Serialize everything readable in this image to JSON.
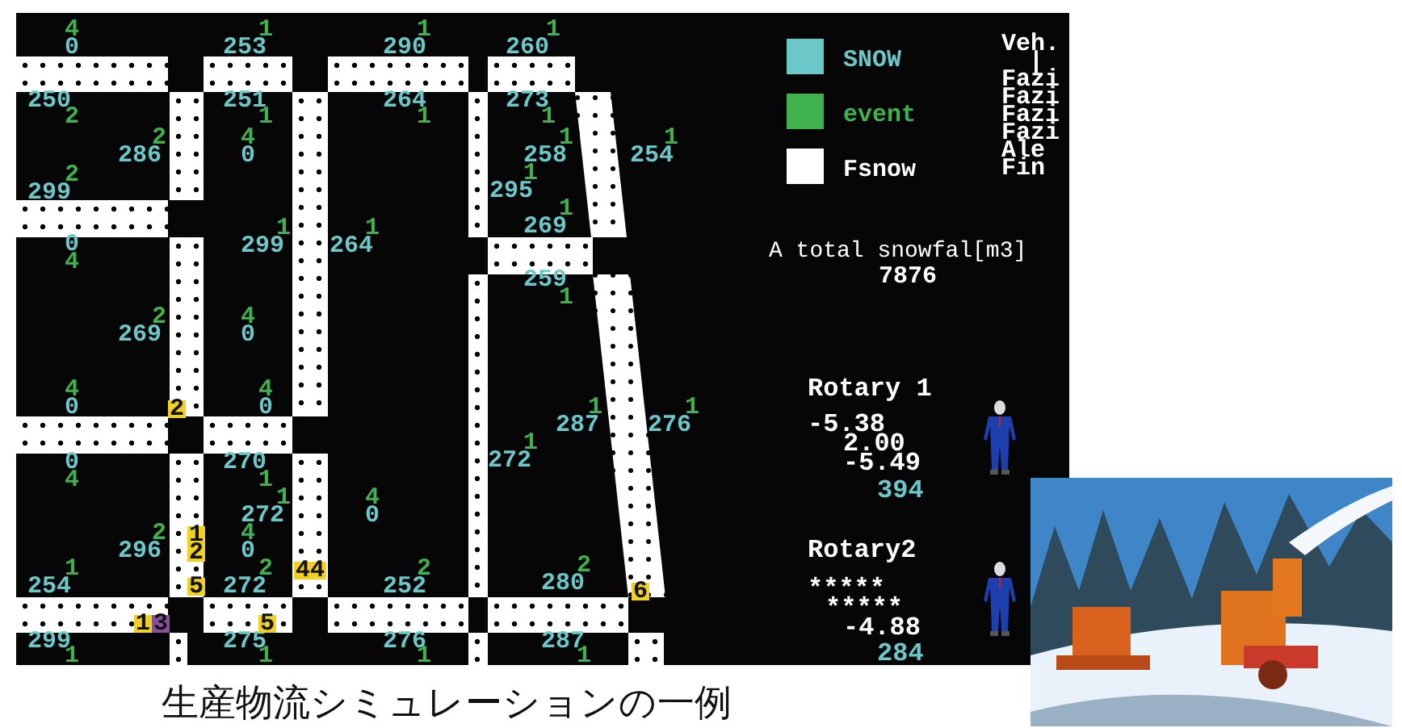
{
  "map_labels": [
    {
      "text": "4",
      "kind": "event"
    },
    {
      "text": "0",
      "kind": "snow"
    },
    {
      "text": "1",
      "kind": "event"
    },
    {
      "text": "253",
      "kind": "snow"
    },
    {
      "text": "1",
      "kind": "event"
    },
    {
      "text": "290",
      "kind": "snow"
    },
    {
      "text": "1",
      "kind": "event"
    },
    {
      "text": "260",
      "kind": "snow"
    },
    {
      "text": "250",
      "kind": "snow"
    },
    {
      "text": "2",
      "kind": "event"
    },
    {
      "text": "251",
      "kind": "snow"
    },
    {
      "text": "1",
      "kind": "event"
    },
    {
      "text": "264",
      "kind": "snow"
    },
    {
      "text": "1",
      "kind": "event"
    },
    {
      "text": "273",
      "kind": "snow"
    },
    {
      "text": "1",
      "kind": "event"
    },
    {
      "text": "2",
      "kind": "event"
    },
    {
      "text": "286",
      "kind": "snow"
    },
    {
      "text": "4",
      "kind": "event"
    },
    {
      "text": "0",
      "kind": "snow"
    },
    {
      "text": "1",
      "kind": "event"
    },
    {
      "text": "258",
      "kind": "snow"
    },
    {
      "text": "1",
      "kind": "event"
    },
    {
      "text": "254",
      "kind": "snow"
    },
    {
      "text": "2",
      "kind": "event"
    },
    {
      "text": "299",
      "kind": "snow"
    },
    {
      "text": "1",
      "kind": "event"
    },
    {
      "text": "295",
      "kind": "snow"
    },
    {
      "text": "1",
      "kind": "event"
    },
    {
      "text": "299",
      "kind": "snow"
    },
    {
      "text": "1",
      "kind": "event"
    },
    {
      "text": "264",
      "kind": "snow"
    },
    {
      "text": "1",
      "kind": "event"
    },
    {
      "text": "269",
      "kind": "snow"
    },
    {
      "text": "0",
      "kind": "snow"
    },
    {
      "text": "4",
      "kind": "event"
    },
    {
      "text": "259",
      "kind": "snow"
    },
    {
      "text": "1",
      "kind": "event"
    },
    {
      "text": "2",
      "kind": "event"
    },
    {
      "text": "269",
      "kind": "snow"
    },
    {
      "text": "4",
      "kind": "event"
    },
    {
      "text": "0",
      "kind": "snow"
    },
    {
      "text": "4",
      "kind": "event"
    },
    {
      "text": "0",
      "kind": "snow"
    },
    {
      "text": "4",
      "kind": "event"
    },
    {
      "text": "0",
      "kind": "snow"
    },
    {
      "text": "1",
      "kind": "event"
    },
    {
      "text": "287",
      "kind": "snow"
    },
    {
      "text": "1",
      "kind": "event"
    },
    {
      "text": "276",
      "kind": "snow"
    },
    {
      "text": "0",
      "kind": "snow"
    },
    {
      "text": "4",
      "kind": "event"
    },
    {
      "text": "270",
      "kind": "snow"
    },
    {
      "text": "1",
      "kind": "event"
    },
    {
      "text": "1",
      "kind": "event"
    },
    {
      "text": "272",
      "kind": "snow"
    },
    {
      "text": "1",
      "kind": "event"
    },
    {
      "text": "272",
      "kind": "snow"
    },
    {
      "text": "4",
      "kind": "event"
    },
    {
      "text": "0",
      "kind": "snow"
    },
    {
      "text": "2",
      "kind": "event"
    },
    {
      "text": "296",
      "kind": "snow"
    },
    {
      "text": "4",
      "kind": "event"
    },
    {
      "text": "0",
      "kind": "snow"
    },
    {
      "text": "1",
      "kind": "event"
    },
    {
      "text": "254",
      "kind": "snow"
    },
    {
      "text": "2",
      "kind": "event"
    },
    {
      "text": "272",
      "kind": "snow"
    },
    {
      "text": "2",
      "kind": "event"
    },
    {
      "text": "252",
      "kind": "snow"
    },
    {
      "text": "2",
      "kind": "event"
    },
    {
      "text": "280",
      "kind": "snow"
    },
    {
      "text": "299",
      "kind": "snow"
    },
    {
      "text": "1",
      "kind": "event"
    },
    {
      "text": "275",
      "kind": "snow"
    },
    {
      "text": "1",
      "kind": "event"
    },
    {
      "text": "276",
      "kind": "snow"
    },
    {
      "text": "1",
      "kind": "event"
    },
    {
      "text": "287",
      "kind": "snow"
    },
    {
      "text": "1",
      "kind": "event"
    }
  ],
  "vehicle_markers": [
    {
      "text": "2",
      "color": "#f0d020"
    },
    {
      "text": "1",
      "color": "#f0d020"
    },
    {
      "text": "2",
      "color": "#f0d020"
    },
    {
      "text": "5",
      "color": "#f0d020"
    },
    {
      "text": "44",
      "color": "#f0d020"
    },
    {
      "text": "1",
      "color": "#f0d020"
    },
    {
      "text": "3",
      "color": "#8a4f9c"
    },
    {
      "text": "5",
      "color": "#f0d020"
    },
    {
      "text": "6",
      "color": "#f0d020"
    }
  ],
  "legend": [
    {
      "label": "SNOW",
      "kind": "snow"
    },
    {
      "label": "event",
      "kind": "event"
    },
    {
      "label": "Fsnow",
      "kind": "fsnow"
    }
  ],
  "vehicle_list": {
    "title": "Veh.",
    "lines": [
      "|",
      "Fazi",
      "Fazi",
      "Fazi",
      "Fazi",
      "Ale",
      "Fin"
    ]
  },
  "total_snowfall": {
    "label": "A total snowfal[m3]",
    "value": "7876"
  },
  "rotaries": [
    {
      "name": "Rotary 1",
      "readings": [
        "-5.38",
        "2.00",
        "-5.49"
      ],
      "total": "394"
    },
    {
      "name": "Rotary2",
      "readings": [
        "*****",
        "*****",
        "-4.88"
      ],
      "total": "284"
    }
  ],
  "caption": "生産物流シミュレーションの一例"
}
